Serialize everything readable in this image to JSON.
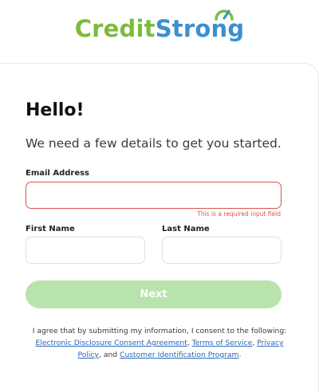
{
  "brand": {
    "part1": "Credit",
    "part2": "Strong",
    "color_green": "#7dbb3a",
    "color_blue": "#3b8fd0"
  },
  "form": {
    "heading": "Hello!",
    "subtitle": "We need a few details to get you started.",
    "email": {
      "label": "Email Address",
      "value": "",
      "error": "This is a required input field"
    },
    "first_name": {
      "label": "First Name",
      "value": ""
    },
    "last_name": {
      "label": "Last Name",
      "value": ""
    },
    "next_label": "Next"
  },
  "consent": {
    "prefix": "I agree that by submitting my information, I consent to the following: ",
    "link_edca": "Electronic Disclosure Consent Agreement",
    "sep1": ", ",
    "link_terms": "Terms of Service",
    "sep2": ", ",
    "link_privacy": "Privacy Policy",
    "sep3": ", and ",
    "link_cip": "Customer Identification Program",
    "suffix": "."
  },
  "colors": {
    "error": "#d9534f",
    "button_disabled": "#b9e3ad",
    "link": "#2a66b8"
  }
}
